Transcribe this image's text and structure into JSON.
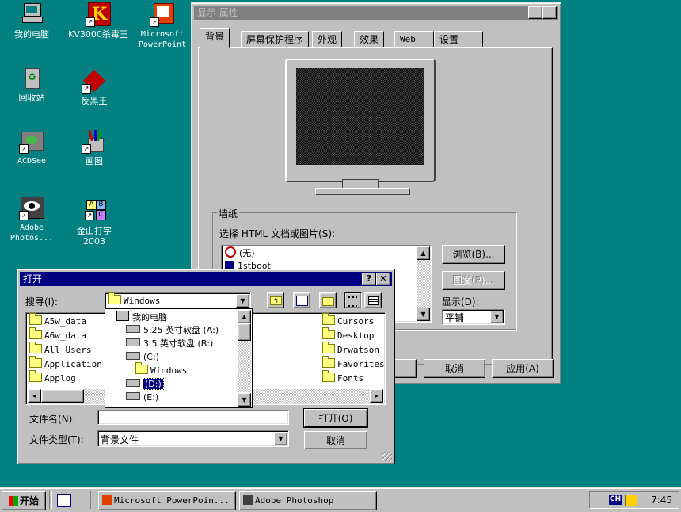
{
  "desktop": {
    "icons": [
      {
        "label": "我的电脑"
      },
      {
        "label": "KV3000杀毒王"
      },
      {
        "label": "Microsoft PowerPoint"
      },
      {
        "label": "回收站"
      },
      {
        "label": "反黑王"
      },
      {
        "label": "ACDSee"
      },
      {
        "label": "画图"
      },
      {
        "label": "Adobe Photos..."
      },
      {
        "label": "金山打字 2003"
      }
    ]
  },
  "display_props": {
    "title": "显示 属性",
    "tabs": [
      "背景",
      "屏幕保护程序",
      "外观",
      "效果",
      "Web",
      "设置"
    ],
    "wallpaper_group": "墙纸",
    "choose_label": "选择 HTML 文档或图片(S):",
    "list": [
      "(无)",
      "1stboot"
    ],
    "browse_btn": "浏览(B)...",
    "pattern_btn": "图案(P)...",
    "display_label": "显示(D):",
    "display_value": "平铺",
    "cancel_btn": "取消",
    "apply_btn": "应用(A)"
  },
  "open_dialog": {
    "title": "打开",
    "look_in_label": "搜寻(I):",
    "look_in_value": "Windows",
    "left_files": [
      "A5w_data",
      "A6w_data",
      "All Users",
      "Application",
      "Applog"
    ],
    "right_files": [
      "Cursors",
      "Desktop",
      "Drwatson",
      "Favorites",
      "Fonts"
    ],
    "dropdown_items": [
      "我的电脑",
      "5.25 英寸软盘 (A:)",
      "3.5 英寸软盘 (B:)",
      "(C:)",
      "Windows",
      "(D:)",
      "(E:)"
    ],
    "filename_label": "文件名(N):",
    "filename_value": "",
    "filetype_label": "文件类型(T):",
    "filetype_value": "背景文件",
    "open_btn": "打开(O)",
    "cancel_btn": "取消"
  },
  "taskbar": {
    "start": "开始",
    "tasks": [
      "Microsoft PowerPoin...",
      "Adobe Photoshop"
    ],
    "tray_lang": "CH",
    "clock": "7:45"
  },
  "colors": {
    "desktop": "#008080",
    "titlebar_active": "#000080",
    "face": "#c0c0c0"
  }
}
